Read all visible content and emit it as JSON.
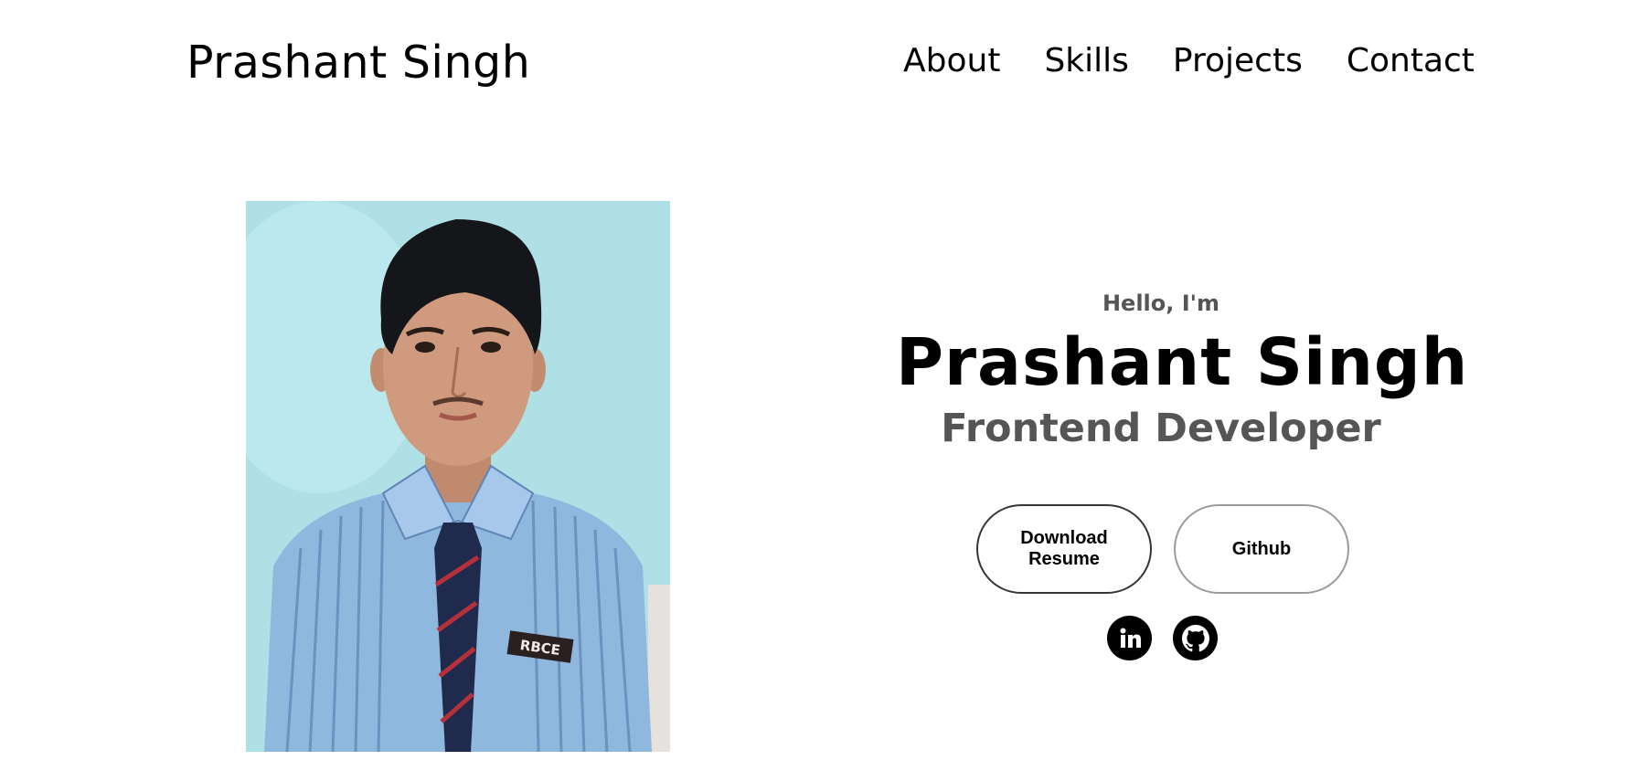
{
  "header": {
    "logo_text": "Prashant Singh",
    "nav": [
      {
        "label": "About"
      },
      {
        "label": "Skills"
      },
      {
        "label": "Projects"
      },
      {
        "label": "Contact"
      }
    ]
  },
  "profile": {
    "image_alt": "profile picture",
    "shirt_badge_text": "RBCE"
  },
  "intro": {
    "greeting": "Hello, I'm",
    "name": "Prashant Singh",
    "role": "Frontend Developer"
  },
  "buttons": {
    "resume_label": "Download Resume",
    "github_label": "Github"
  },
  "socials": [
    {
      "icon": "linkedin-icon"
    },
    {
      "icon": "github-icon"
    }
  ],
  "colors": {
    "text": "#000000",
    "muted_text": "#555555",
    "primary_border": "#353535",
    "secondary_border": "#9a9a9a",
    "photo_background": "#a8dde3"
  }
}
